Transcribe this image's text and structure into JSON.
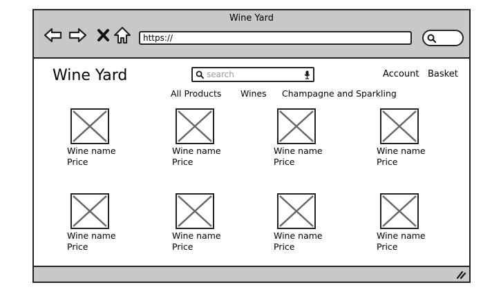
{
  "window": {
    "title": "Wine Yard"
  },
  "browser": {
    "url": "https://",
    "icons": [
      "back-arrow-icon",
      "forward-arrow-icon",
      "close-icon",
      "home-icon",
      "search-icon"
    ]
  },
  "site": {
    "brand": "Wine Yard",
    "search": {
      "placeholder": "search"
    },
    "account": "Account",
    "basket": "Basket",
    "categories": [
      "All Products",
      "Wines",
      "Champagne and Sparkling"
    ]
  },
  "products": [
    {
      "name": "Wine name",
      "price": "Price"
    },
    {
      "name": "Wine name",
      "price": "Price"
    },
    {
      "name": "Wine name",
      "price": "Price"
    },
    {
      "name": "Wine name",
      "price": "Price"
    },
    {
      "name": "Wine name",
      "price": "Price"
    },
    {
      "name": "Wine name",
      "price": "Price"
    },
    {
      "name": "Wine name",
      "price": "Price"
    },
    {
      "name": "Wine name",
      "price": "Price"
    }
  ]
}
